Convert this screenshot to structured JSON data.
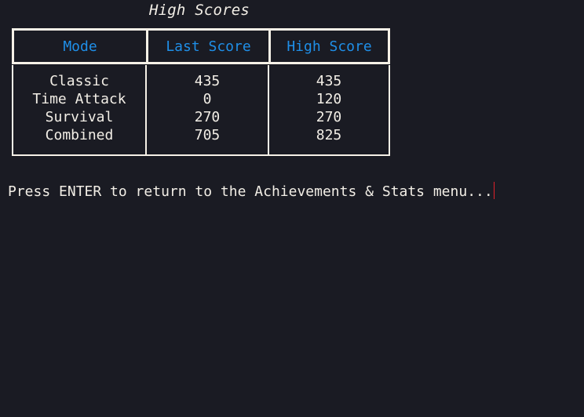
{
  "title": "High Scores",
  "table": {
    "headers": [
      "Mode",
      "Last Score",
      "High Score"
    ],
    "rows": [
      {
        "mode": "Classic",
        "last": "435",
        "high": "435"
      },
      {
        "mode": "Time Attack",
        "last": "0",
        "high": "120"
      },
      {
        "mode": "Survival",
        "last": "270",
        "high": "270"
      },
      {
        "mode": "Combined",
        "last": "705",
        "high": "825"
      }
    ]
  },
  "prompt": "Press ENTER to return to the Achievements & Stats menu...",
  "colors": {
    "background": "#1a1b23",
    "header_text": "#1f8fe8",
    "text": "#f2eee6",
    "border": "#f6f1e7",
    "cursor": "#e0202a"
  }
}
